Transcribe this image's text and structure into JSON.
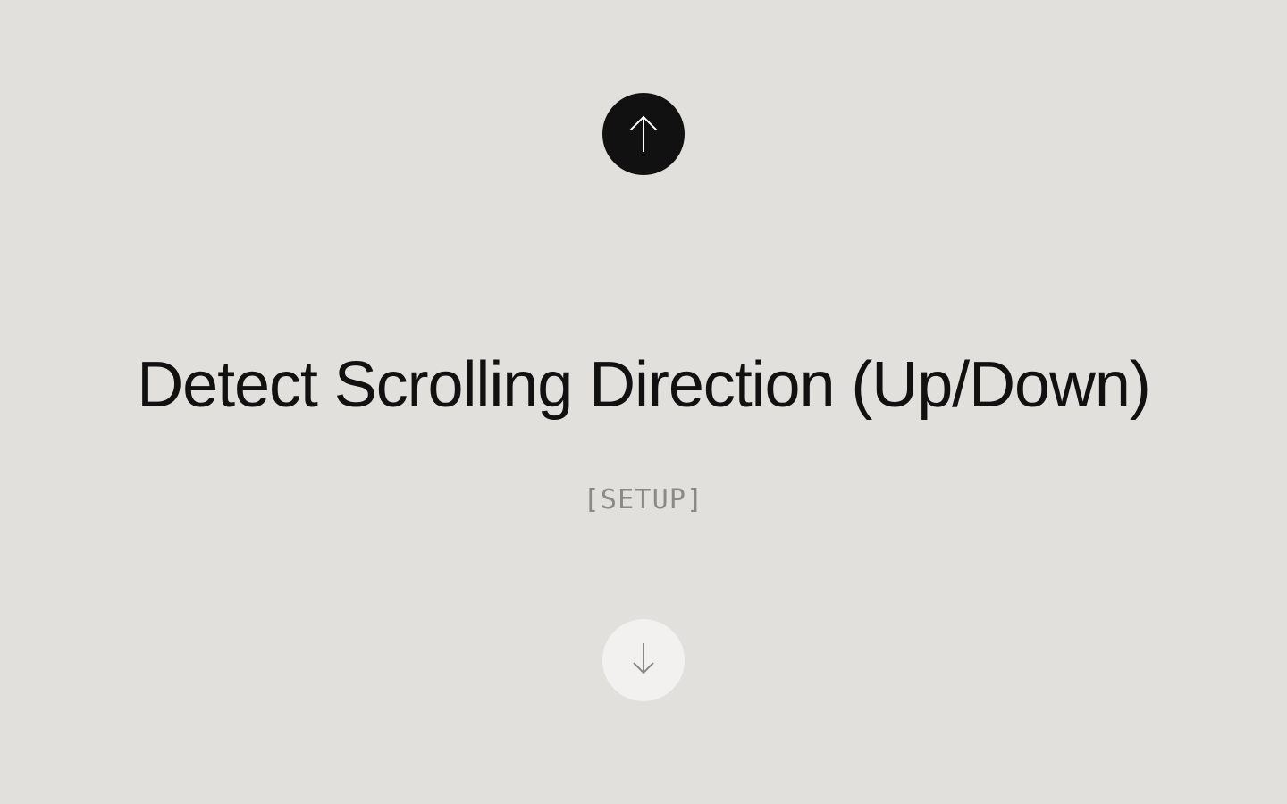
{
  "heading": "Detect Scrolling Direction (Up/Down)",
  "subtitle": "[SETUP]",
  "icons": {
    "up": "arrow-up-icon",
    "down": "arrow-down-icon"
  }
}
